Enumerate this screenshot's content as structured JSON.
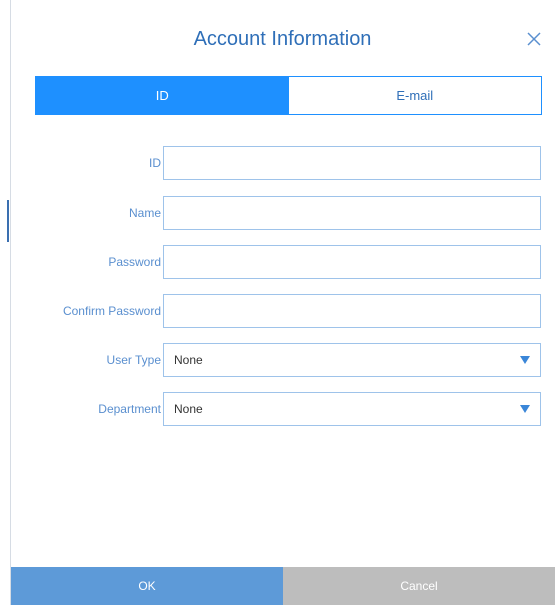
{
  "dialog": {
    "title": "Account Information",
    "close_icon": "close-icon"
  },
  "tabs": [
    {
      "label": "ID",
      "active": true
    },
    {
      "label": "E-mail",
      "active": false
    }
  ],
  "form": {
    "id_label": "ID",
    "id_value": "",
    "name_label": "Name",
    "name_value": "",
    "password_label": "Password",
    "password_value": "",
    "confirm_password_label": "Confirm Password",
    "confirm_password_value": "",
    "user_type_label": "User Type",
    "user_type_value": "None",
    "department_label": "Department",
    "department_value": "None"
  },
  "footer": {
    "ok_label": "OK",
    "cancel_label": "Cancel"
  },
  "colors": {
    "accent": "#1e90ff",
    "title": "#2f6fb8",
    "label": "#5a8fcf",
    "ok_button": "#5d9ad8",
    "cancel_button": "#bdbdbd"
  }
}
